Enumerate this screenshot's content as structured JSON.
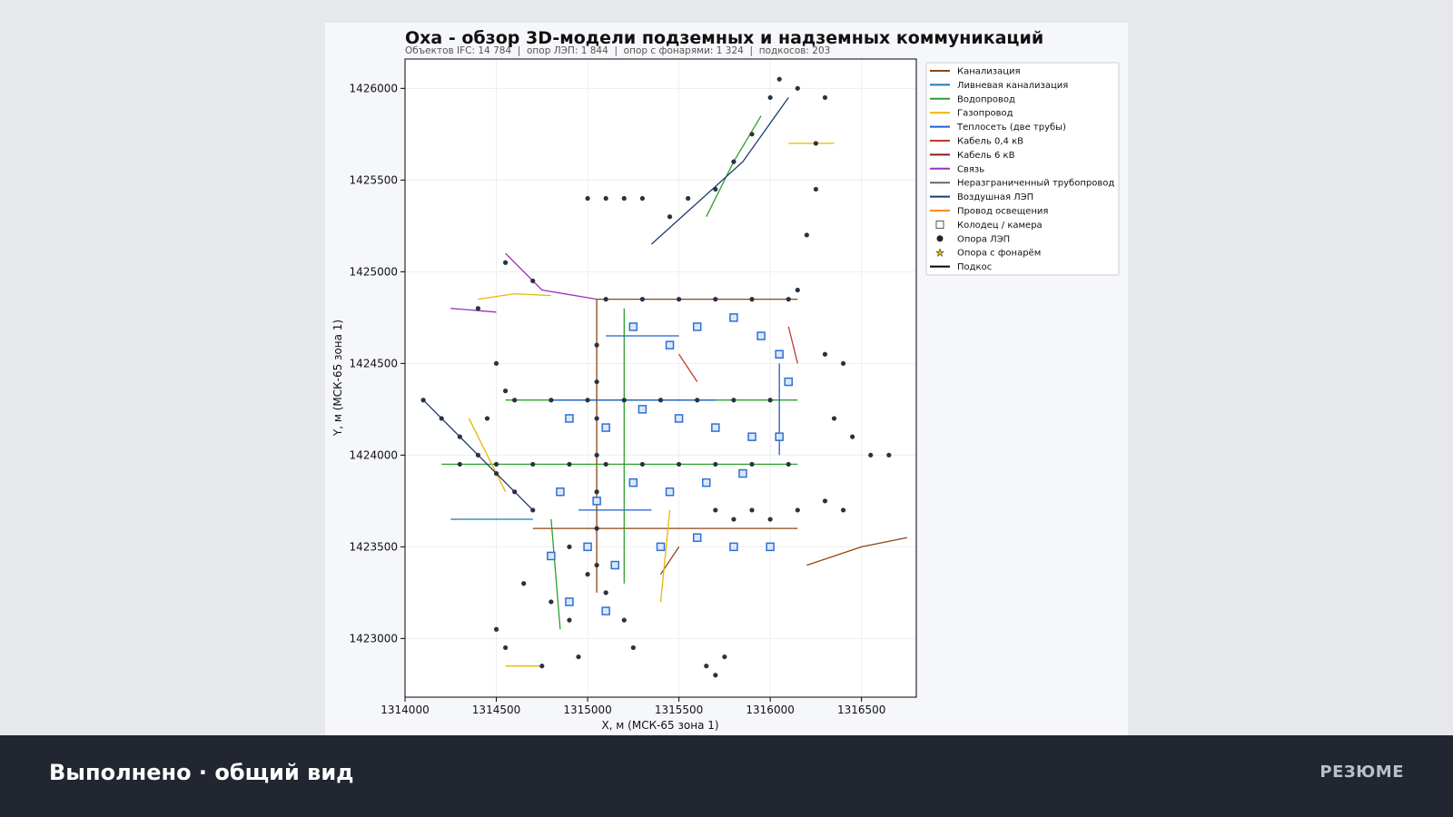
{
  "footer": {
    "title": "Выполнено · общий вид",
    "section": "РЕЗЮМЕ"
  },
  "chart_data": {
    "type": "scatter",
    "title": "Оха - обзор 3D-модели подземных и надземных коммуникаций",
    "subtitle": "Объектов IFC: 14 784  |  опор ЛЭП: 1 844  |  опор с фонарями: 1 324  |  подкосов: 203",
    "xlabel": "X, м (МСК-65 зона 1)",
    "ylabel": "Y, м (МСК-65 зона 1)",
    "xlim": [
      1314000,
      1316800
    ],
    "ylim": [
      1422680,
      1426160
    ],
    "xticks": [
      "1314000",
      "1314500",
      "1315000",
      "1315500",
      "1316000",
      "1316500"
    ],
    "yticks": [
      "1423000",
      "1423500",
      "1424000",
      "1424500",
      "1425000",
      "1425500",
      "1426000"
    ],
    "grid": true,
    "legend_position": "top-right (outside axes)",
    "legend": [
      {
        "label": "Канализация",
        "kind": "line",
        "color": "#8b4513"
      },
      {
        "label": "Ливневая канализация",
        "kind": "line",
        "color": "#1f77b4"
      },
      {
        "label": "Водопровод",
        "kind": "line",
        "color": "#2ca02c"
      },
      {
        "label": "Газопровод",
        "kind": "line",
        "color": "#e6b800"
      },
      {
        "label": "Теплосеть (две трубы)",
        "kind": "line",
        "color": "#1f5fd6"
      },
      {
        "label": "Кабель 0,4 кВ",
        "kind": "line",
        "color": "#c0392b"
      },
      {
        "label": "Кабель 6 кВ",
        "kind": "line",
        "color": "#8b1a1a"
      },
      {
        "label": "Связь",
        "kind": "line",
        "color": "#9b30b8"
      },
      {
        "label": "Неразграниченный трубопровод",
        "kind": "line",
        "color": "#666666"
      },
      {
        "label": "Воздушная ЛЭП",
        "kind": "line",
        "color": "#1a3c6e"
      },
      {
        "label": "Провод освещения",
        "kind": "line",
        "color": "#ff8c00"
      },
      {
        "label": "Колодец / камера",
        "kind": "square",
        "color": "#555555"
      },
      {
        "label": "Опора ЛЭП",
        "kind": "circle",
        "color": "#222222"
      },
      {
        "label": "Опора с фонарём",
        "kind": "star",
        "color": "#e6b800"
      },
      {
        "label": "Подкос",
        "kind": "line",
        "color": "#000000"
      }
    ],
    "series": [
      {
        "name": "Канализация",
        "color": "#8b4513",
        "lines": [
          [
            [
              1315050,
              1424850
            ],
            [
              1316150,
              1424850
            ]
          ],
          [
            [
              1315050,
              1424850
            ],
            [
              1315050,
              1423250
            ]
          ],
          [
            [
              1314700,
              1423600
            ],
            [
              1316150,
              1423600
            ]
          ],
          [
            [
              1316200,
              1423400
            ],
            [
              1316500,
              1423500
            ],
            [
              1316750,
              1423550
            ]
          ],
          [
            [
              1315400,
              1423350
            ],
            [
              1315500,
              1423500
            ]
          ]
        ]
      },
      {
        "name": "Водопровод",
        "color": "#2ca02c",
        "lines": [
          [
            [
              1314550,
              1424300
            ],
            [
              1316150,
              1424300
            ]
          ],
          [
            [
              1314200,
              1423950
            ],
            [
              1316150,
              1423950
            ]
          ],
          [
            [
              1315650,
              1425300
            ],
            [
              1315800,
              1425600
            ],
            [
              1315950,
              1425850
            ]
          ],
          [
            [
              1315200,
              1424800
            ],
            [
              1315200,
              1423300
            ]
          ],
          [
            [
              1314800,
              1423650
            ],
            [
              1314850,
              1423050
            ]
          ]
        ]
      },
      {
        "name": "Газопровод",
        "color": "#e6b800",
        "lines": [
          [
            [
              1314400,
              1424850
            ],
            [
              1314600,
              1424880
            ],
            [
              1314800,
              1424870
            ]
          ],
          [
            [
              1314350,
              1424200
            ],
            [
              1314450,
              1424000
            ],
            [
              1314550,
              1423800
            ]
          ],
          [
            [
              1314550,
              1422850
            ],
            [
              1314750,
              1422850
            ]
          ],
          [
            [
              1316100,
              1425700
            ],
            [
              1316350,
              1425700
            ]
          ],
          [
            [
              1315400,
              1423200
            ],
            [
              1315450,
              1423700
            ]
          ]
        ]
      },
      {
        "name": "Теплосеть (две трубы)",
        "color": "#1f5fd6",
        "lines": [
          [
            [
              1314800,
              1424300
            ],
            [
              1315700,
              1424300
            ]
          ],
          [
            [
              1315100,
              1424650
            ],
            [
              1315500,
              1424650
            ]
          ],
          [
            [
              1314950,
              1423700
            ],
            [
              1315350,
              1423700
            ]
          ],
          [
            [
              1316050,
              1424500
            ],
            [
              1316050,
              1424000
            ]
          ]
        ]
      },
      {
        "name": "Связь",
        "color": "#9b30b8",
        "lines": [
          [
            [
              1314550,
              1425100
            ],
            [
              1314750,
              1424900
            ],
            [
              1315050,
              1424850
            ]
          ],
          [
            [
              1314250,
              1424800
            ],
            [
              1314500,
              1424780
            ]
          ]
        ]
      },
      {
        "name": "Воздушная ЛЭП",
        "color": "#1a3c6e",
        "lines": [
          [
            [
              1314100,
              1424300
            ],
            [
              1314400,
              1424000
            ],
            [
              1314700,
              1423700
            ]
          ],
          [
            [
              1315350,
              1425150
            ],
            [
              1315850,
              1425600
            ],
            [
              1316100,
              1425950
            ]
          ]
        ]
      },
      {
        "name": "Ливневая канализация",
        "color": "#1f77b4",
        "lines": [
          [
            [
              1314250,
              1423650
            ],
            [
              1314700,
              1423650
            ]
          ]
        ]
      },
      {
        "name": "Кабель 0,4 кВ",
        "color": "#c0392b",
        "lines": [
          [
            [
              1315500,
              1424550
            ],
            [
              1315600,
              1424400
            ]
          ],
          [
            [
              1316100,
              1424700
            ],
            [
              1316150,
              1424500
            ]
          ]
        ]
      }
    ],
    "towers": [
      [
        1314100,
        1424300
      ],
      [
        1314200,
        1424200
      ],
      [
        1314300,
        1424100
      ],
      [
        1314400,
        1424000
      ],
      [
        1314500,
        1423900
      ],
      [
        1314600,
        1423800
      ],
      [
        1314700,
        1423700
      ],
      [
        1314400,
        1424800
      ],
      [
        1314550,
        1425050
      ],
      [
        1314700,
        1424950
      ],
      [
        1314650,
        1423300
      ],
      [
        1314500,
        1423050
      ],
      [
        1314550,
        1422950
      ],
      [
        1314750,
        1422850
      ],
      [
        1314950,
        1422900
      ],
      [
        1315000,
        1425400
      ],
      [
        1315100,
        1425400
      ],
      [
        1315200,
        1425400
      ],
      [
        1315300,
        1425400
      ],
      [
        1315450,
        1425300
      ],
      [
        1315550,
        1425400
      ],
      [
        1315700,
        1425450
      ],
      [
        1315800,
        1425600
      ],
      [
        1315900,
        1425750
      ],
      [
        1316000,
        1425950
      ],
      [
        1316050,
        1426050
      ],
      [
        1316150,
        1426000
      ],
      [
        1316300,
        1425950
      ],
      [
        1316250,
        1425700
      ],
      [
        1316250,
        1425450
      ],
      [
        1316200,
        1425200
      ],
      [
        1316150,
        1424900
      ],
      [
        1315100,
        1424850
      ],
      [
        1315300,
        1424850
      ],
      [
        1315500,
        1424850
      ],
      [
        1315700,
        1424850
      ],
      [
        1315900,
        1424850
      ],
      [
        1316100,
        1424850
      ],
      [
        1315050,
        1424600
      ],
      [
        1315050,
        1424400
      ],
      [
        1315050,
        1424200
      ],
      [
        1315050,
        1424000
      ],
      [
        1315050,
        1423800
      ],
      [
        1315050,
        1423600
      ],
      [
        1315050,
        1423400
      ],
      [
        1314600,
        1424300
      ],
      [
        1314800,
        1424300
      ],
      [
        1315000,
        1424300
      ],
      [
        1315200,
        1424300
      ],
      [
        1315400,
        1424300
      ],
      [
        1315600,
        1424300
      ],
      [
        1315800,
        1424300
      ],
      [
        1316000,
        1424300
      ],
      [
        1314300,
        1423950
      ],
      [
        1314500,
        1423950
      ],
      [
        1314700,
        1423950
      ],
      [
        1314900,
        1423950
      ],
      [
        1315100,
        1423950
      ],
      [
        1315300,
        1423950
      ],
      [
        1315500,
        1423950
      ],
      [
        1315700,
        1423950
      ],
      [
        1315900,
        1423950
      ],
      [
        1316100,
        1423950
      ],
      [
        1315700,
        1423700
      ],
      [
        1315800,
        1423650
      ],
      [
        1315900,
        1423700
      ],
      [
        1316000,
        1423650
      ],
      [
        1316150,
        1423700
      ],
      [
        1316300,
        1423750
      ],
      [
        1316400,
        1423700
      ],
      [
        1316350,
        1424200
      ],
      [
        1316450,
        1424100
      ],
      [
        1316550,
        1424000
      ],
      [
        1316650,
        1424000
      ],
      [
        1316300,
        1424550
      ],
      [
        1316400,
        1424500
      ],
      [
        1314500,
        1424500
      ],
      [
        1314550,
        1424350
      ],
      [
        1314450,
        1424200
      ],
      [
        1314900,
        1423500
      ],
      [
        1315000,
        1423350
      ],
      [
        1315100,
        1423250
      ],
      [
        1315200,
        1423100
      ],
      [
        1315250,
        1422950
      ],
      [
        1314800,
        1423200
      ],
      [
        1314900,
        1423100
      ],
      [
        1315650,
        1422850
      ],
      [
        1315750,
        1422900
      ],
      [
        1315700,
        1422800
      ]
    ],
    "wells": [
      [
        1315250,
        1424700
      ],
      [
        1315450,
        1424600
      ],
      [
        1315600,
        1424700
      ],
      [
        1315800,
        1424750
      ],
      [
        1315950,
        1424650
      ],
      [
        1316050,
        1424550
      ],
      [
        1316100,
        1424400
      ],
      [
        1314900,
        1424200
      ],
      [
        1315100,
        1424150
      ],
      [
        1315300,
        1424250
      ],
      [
        1315500,
        1424200
      ],
      [
        1315700,
        1424150
      ],
      [
        1315900,
        1424100
      ],
      [
        1316050,
        1424100
      ],
      [
        1314850,
        1423800
      ],
      [
        1315050,
        1423750
      ],
      [
        1315250,
        1423850
      ],
      [
        1315450,
        1423800
      ],
      [
        1315650,
        1423850
      ],
      [
        1315850,
        1423900
      ],
      [
        1314800,
        1423450
      ],
      [
        1315000,
        1423500
      ],
      [
        1315150,
        1423400
      ],
      [
        1315400,
        1423500
      ],
      [
        1315600,
        1423550
      ],
      [
        1315800,
        1423500
      ],
      [
        1316000,
        1423500
      ],
      [
        1314900,
        1423200
      ],
      [
        1315100,
        1423150
      ]
    ]
  }
}
